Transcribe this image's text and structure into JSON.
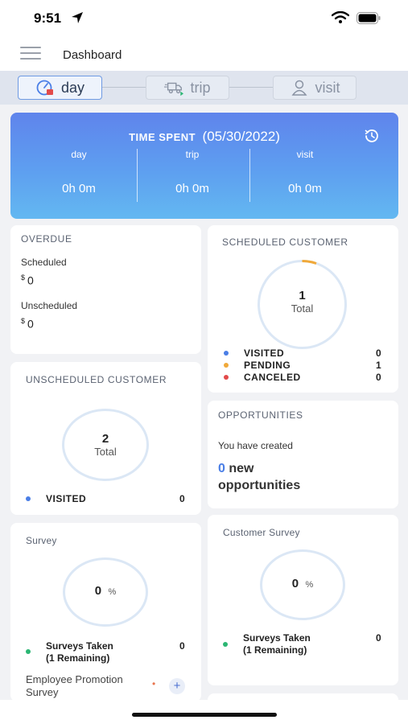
{
  "status_bar": {
    "time": "9:51"
  },
  "header": {
    "title": "Dashboard"
  },
  "tabs": [
    {
      "label": "day",
      "icon": "speedometer-icon",
      "active": true
    },
    {
      "label": "trip",
      "icon": "truck-icon",
      "active": false
    },
    {
      "label": "visit",
      "icon": "person-icon",
      "active": false
    }
  ],
  "time_spent": {
    "label": "TIME SPENT",
    "date": "(05/30/2022)",
    "columns": [
      {
        "label": "day",
        "value": "0h 0m"
      },
      {
        "label": "trip",
        "value": "0h 0m"
      },
      {
        "label": "visit",
        "value": "0h 0m"
      }
    ]
  },
  "overdue": {
    "title": "OVERDUE",
    "scheduled_label": "Scheduled",
    "scheduled_currency": "$",
    "scheduled_value": "0",
    "unscheduled_label": "Unscheduled",
    "unscheduled_currency": "$",
    "unscheduled_value": "0"
  },
  "scheduled_customer": {
    "title": "SCHEDULED CUSTOMER",
    "total": "1",
    "total_label": "Total",
    "legend": [
      {
        "label": "VISITED",
        "value": "0",
        "color": "#4a7ee6"
      },
      {
        "label": "PENDING",
        "value": "1",
        "color": "#f0a93a"
      },
      {
        "label": "CANCELED",
        "value": "0",
        "color": "#e24b4b"
      }
    ]
  },
  "unscheduled_customer": {
    "title": "UNSCHEDULED CUSTOMER",
    "total": "2",
    "total_label": "Total",
    "legend": [
      {
        "label": "VISITED",
        "value": "0",
        "color": "#4a7ee6"
      }
    ]
  },
  "opportunities": {
    "title": "OPPORTUNITIES",
    "created_text": "You have created",
    "count": "0",
    "new_text": "new",
    "opportunities_text": "opportunities"
  },
  "survey": {
    "title": "Survey",
    "percent": "0",
    "percent_sign": "%",
    "taken_label": "Surveys Taken",
    "remaining": "(1 Remaining)",
    "taken_value": "0",
    "item_name": "Employee Promotion Survey",
    "item_marker": "•",
    "add_symbol": "+"
  },
  "customer_survey": {
    "title": "Customer Survey",
    "percent": "0",
    "percent_sign": "%",
    "taken_label": "Surveys Taken",
    "remaining": "(1 Remaining)",
    "taken_value": "0"
  },
  "colors": {
    "accent": "#5f84ec",
    "gradient_end": "#63b8f1",
    "visited": "#4a7ee6",
    "pending": "#f0a93a",
    "canceled": "#e24b4b",
    "survey_dot": "#2bb673"
  }
}
